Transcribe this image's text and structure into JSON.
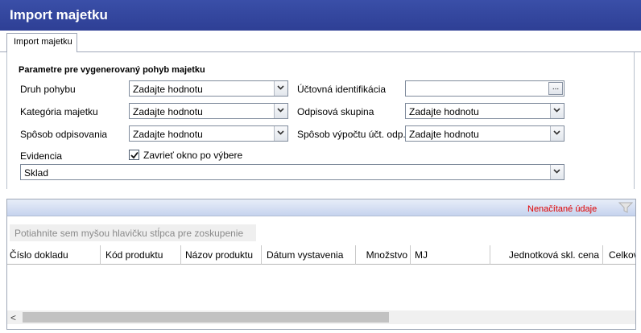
{
  "window": {
    "title": "Import majetku"
  },
  "tab": {
    "label": "Import majetku"
  },
  "params": {
    "group_title": "Parametre pre vygenerovaný pohyb majetku",
    "druh_pohybu": {
      "label": "Druh pohybu",
      "value": "Zadajte hodnotu"
    },
    "kategoria_majetku": {
      "label": "Kategória majetku",
      "value": "Zadajte hodnotu"
    },
    "sposob_odpisovania": {
      "label": "Spôsob odpisovania",
      "value": "Zadajte hodnotu"
    },
    "uctovna_identifikacia": {
      "label": "Účtovná identifikácia",
      "value": "",
      "button": "..."
    },
    "odpisova_skupina": {
      "label": "Odpisová skupina",
      "value": "Zadajte hodnotu"
    },
    "sposob_vypoctu": {
      "label": "Spôsob výpočtu účt. odp.",
      "value": "Zadajte hodnotu"
    },
    "evidencia": {
      "label": "Evidencia",
      "value": "Sklad"
    },
    "close_checkbox": {
      "label": "Zavrieť okno po výbere",
      "checked": true
    }
  },
  "grid": {
    "status": "Nenačítané údaje",
    "group_hint": "Potiahnite sem myšou hlavičku stĺpca pre zoskupenie",
    "columns": [
      "Číslo dokladu",
      "Kód produktu",
      "Názov produktu",
      "Dátum vystavenia",
      "Množstvo",
      "MJ",
      "Jednotková skl. cena",
      "Celkov"
    ],
    "scroll_left": "<"
  },
  "colors": {
    "title_bar": "#2e3f95",
    "status_text": "#e00000"
  }
}
